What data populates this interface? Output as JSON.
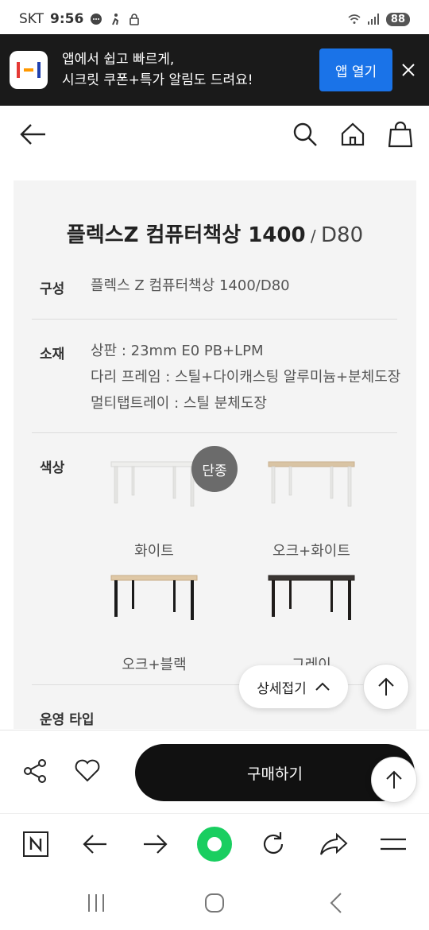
{
  "status_bar": {
    "carrier": "SKT",
    "time": "9:56",
    "battery": "88"
  },
  "app_banner": {
    "line1": "앱에서 쉽고 빠르게,",
    "line2": "시크릿 쿠폰+특가 알림도 드려요!",
    "open_label": "앱 열기",
    "accent_color": "#1a73e8"
  },
  "header": {
    "icons": [
      "back-arrow-icon",
      "search-icon",
      "home-icon",
      "shopping-bag-icon"
    ]
  },
  "product": {
    "title_main": "플렉스Z 컴퓨터책상 1400",
    "title_sep": " / ",
    "title_sub": "D80",
    "specs": [
      {
        "label": "구성",
        "lines": [
          "플렉스 Z 컴퓨터책상 1400/D80"
        ]
      },
      {
        "label": "소재",
        "lines": [
          "상판 : 23mm E0 PB+LPM",
          "다리 프레임 : 스틸+다이캐스팅 알루미늄+분체도장",
          "멀티탭트레이 : 스틸 분체도장"
        ]
      }
    ],
    "color_label": "색상",
    "colors": [
      {
        "name": "화이트",
        "top": "#eeeeec",
        "leg": "#e4e4e2"
      },
      {
        "name": "오크+화이트",
        "top": "#d9c4a4",
        "leg": "#e6e6e4"
      },
      {
        "name": "오크+블랙",
        "top": "#dfc8a6",
        "leg": "#1a1a1a"
      },
      {
        "name": "그레이",
        "top": "#3a3633",
        "leg": "#1f1c1a"
      }
    ],
    "discontinued_badge": "단종",
    "operation_type_label": "운영 타입",
    "collapse_label": "상세접기"
  },
  "buy_bar": {
    "buy_label": "구매하기"
  },
  "browser_bar": {
    "icons": [
      "naver-n-icon",
      "back-arrow-icon",
      "forward-arrow-icon",
      "green-dot-icon",
      "refresh-icon",
      "share-arrow-icon",
      "menu-icon"
    ]
  },
  "system_nav": {
    "icons": [
      "recent-apps-icon",
      "home-circle-icon",
      "back-chevron-icon"
    ]
  }
}
